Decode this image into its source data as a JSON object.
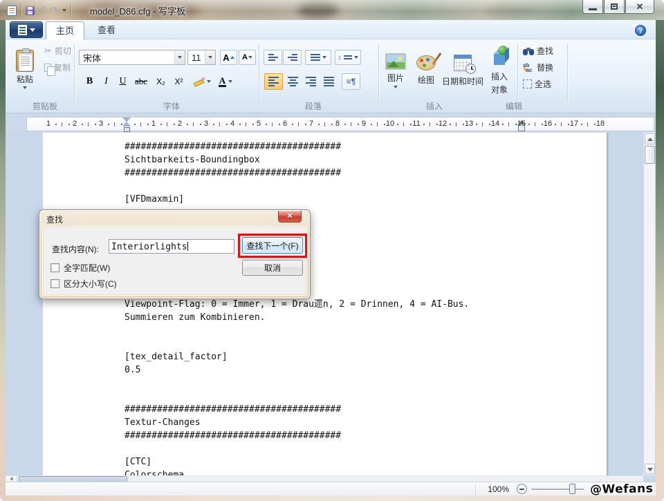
{
  "window": {
    "title": "model_D86.cfg - 写字板"
  },
  "qat": {
    "wordpad_icon": "wordpad-icon",
    "save_icon": "save-icon",
    "undo_icon": "undo-icon",
    "redo_icon": "redo-icon"
  },
  "tabs": {
    "home": "主页",
    "view": "查看"
  },
  "ribbon": {
    "clipboard": {
      "label": "剪贴板",
      "paste": "粘贴",
      "cut": "剪切",
      "copy": "复制"
    },
    "font": {
      "label": "字体",
      "family": "宋体",
      "size": "11",
      "bold": "B",
      "italic": "I",
      "underline": "U",
      "strike": "abc",
      "subscript": "X₂",
      "superscript": "X²",
      "grow": "A",
      "shrink": "A",
      "color": "A"
    },
    "paragraph": {
      "label": "段落"
    },
    "insert": {
      "label": "插入",
      "picture": "图片",
      "drawing": "绘图",
      "datetime": "日期和时间",
      "object_line1": "插入",
      "object_line2": "对象"
    },
    "edit": {
      "label": "编辑",
      "find": "查找",
      "replace": "替换",
      "select_all": "全选"
    }
  },
  "ruler": {
    "left_numbers": [
      "3",
      "2",
      "1"
    ],
    "right_numbers": [
      "1",
      "2",
      "3",
      "4",
      "5",
      "6",
      "7",
      "8",
      "9",
      "10",
      "11",
      "12",
      "13",
      "14",
      "15",
      "16",
      "17",
      "18"
    ]
  },
  "document": {
    "lines": [
      "########################################",
      "Sichtbarkeits-Boundingbox",
      "########################################",
      "",
      "[VFDmaxmin]",
      "",
      "",
      "",
      "",
      "",
      "",
      "",
      "Viewpoint-Flag: 0 = Immer, 1 = Drau遝n, 2 = Drinnen, 4 = AI-Bus.",
      "Summieren zum Kombinieren.",
      "",
      "",
      "[tex_detail_factor]",
      "0.5",
      "",
      "",
      "########################################",
      "Textur-Changes",
      "########################################",
      "",
      "[CTC]",
      "Colorschema"
    ]
  },
  "dialog": {
    "title": "查找",
    "field_label": "查找内容(N):",
    "field_value": "Interiorlights",
    "find_next": "查找下一个(F)",
    "cancel": "取消",
    "match_whole_word": "全字匹配(W)",
    "match_case": "区分大小写(C)",
    "annotation_color": "#e31212"
  },
  "status": {
    "zoom_level": "100%"
  },
  "watermark": "@Wefans",
  "colors": {
    "highlight_orange": "#f9c96b",
    "dialog_frame": "#ecdfc8",
    "close_red": "#c93f2e",
    "app_button_blue": "#274a7d"
  }
}
